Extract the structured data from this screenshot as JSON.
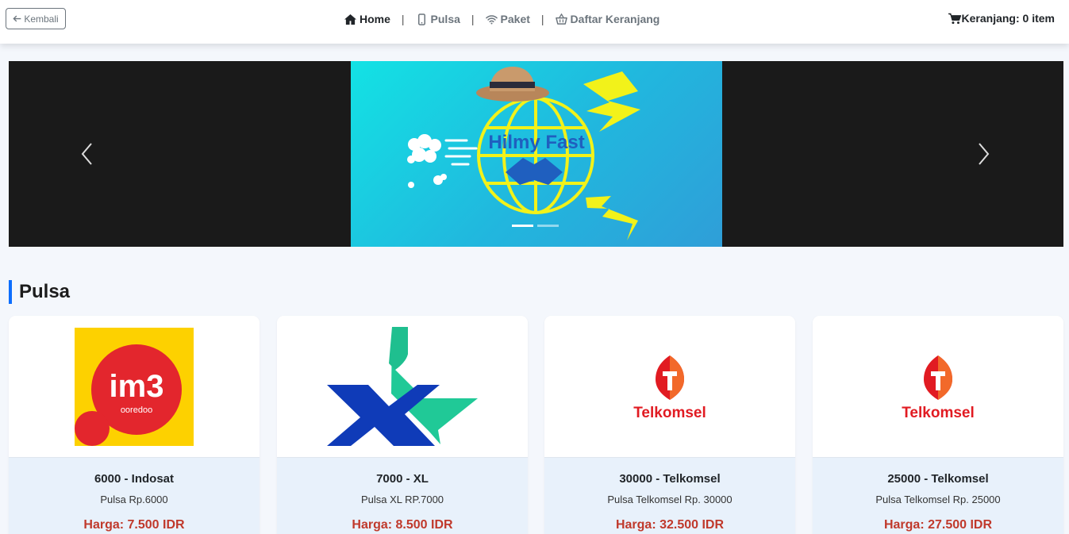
{
  "nav": {
    "back_label": "Kembali",
    "items": [
      {
        "label": "Home",
        "icon": "home-icon",
        "active": true
      },
      {
        "label": "Pulsa",
        "icon": "mobile-icon",
        "active": false
      },
      {
        "label": "Paket",
        "icon": "wifi-icon",
        "active": false
      },
      {
        "label": "Daftar Keranjang",
        "icon": "basket-icon",
        "active": false
      }
    ],
    "separator": "|",
    "cart_label": "Keranjang: 0 item"
  },
  "carousel": {
    "banner_text": "Hilmy Fast",
    "slide_count": 2,
    "active_slide": 1,
    "colors": {
      "background": "#1a1a1a",
      "banner": "#21b7de",
      "globe": "#f2f21a"
    }
  },
  "section": {
    "title": "Pulsa",
    "accent": "#0d6efd"
  },
  "products": [
    {
      "name": "6000 - Indosat",
      "description": "Pulsa Rp.6000",
      "price": "Harga: 7.500 IDR",
      "logo": "im3-ooredoo-logo",
      "logo_text": "im3",
      "logo_subtext": "ooredoo"
    },
    {
      "name": "7000 - XL",
      "description": "Pulsa XL RP.7000",
      "price": "Harga: 8.500 IDR",
      "logo": "xl-logo"
    },
    {
      "name": "30000 - Telkomsel",
      "description": "Pulsa Telkomsel Rp. 30000",
      "price": "Harga: 32.500 IDR",
      "logo": "telkomsel-logo",
      "logo_text": "Telkomsel"
    },
    {
      "name": "25000 - Telkomsel",
      "description": "Pulsa Telkomsel Rp. 25000",
      "price": "Harga: 27.500 IDR",
      "logo": "telkomsel-logo",
      "logo_text": "Telkomsel"
    }
  ]
}
